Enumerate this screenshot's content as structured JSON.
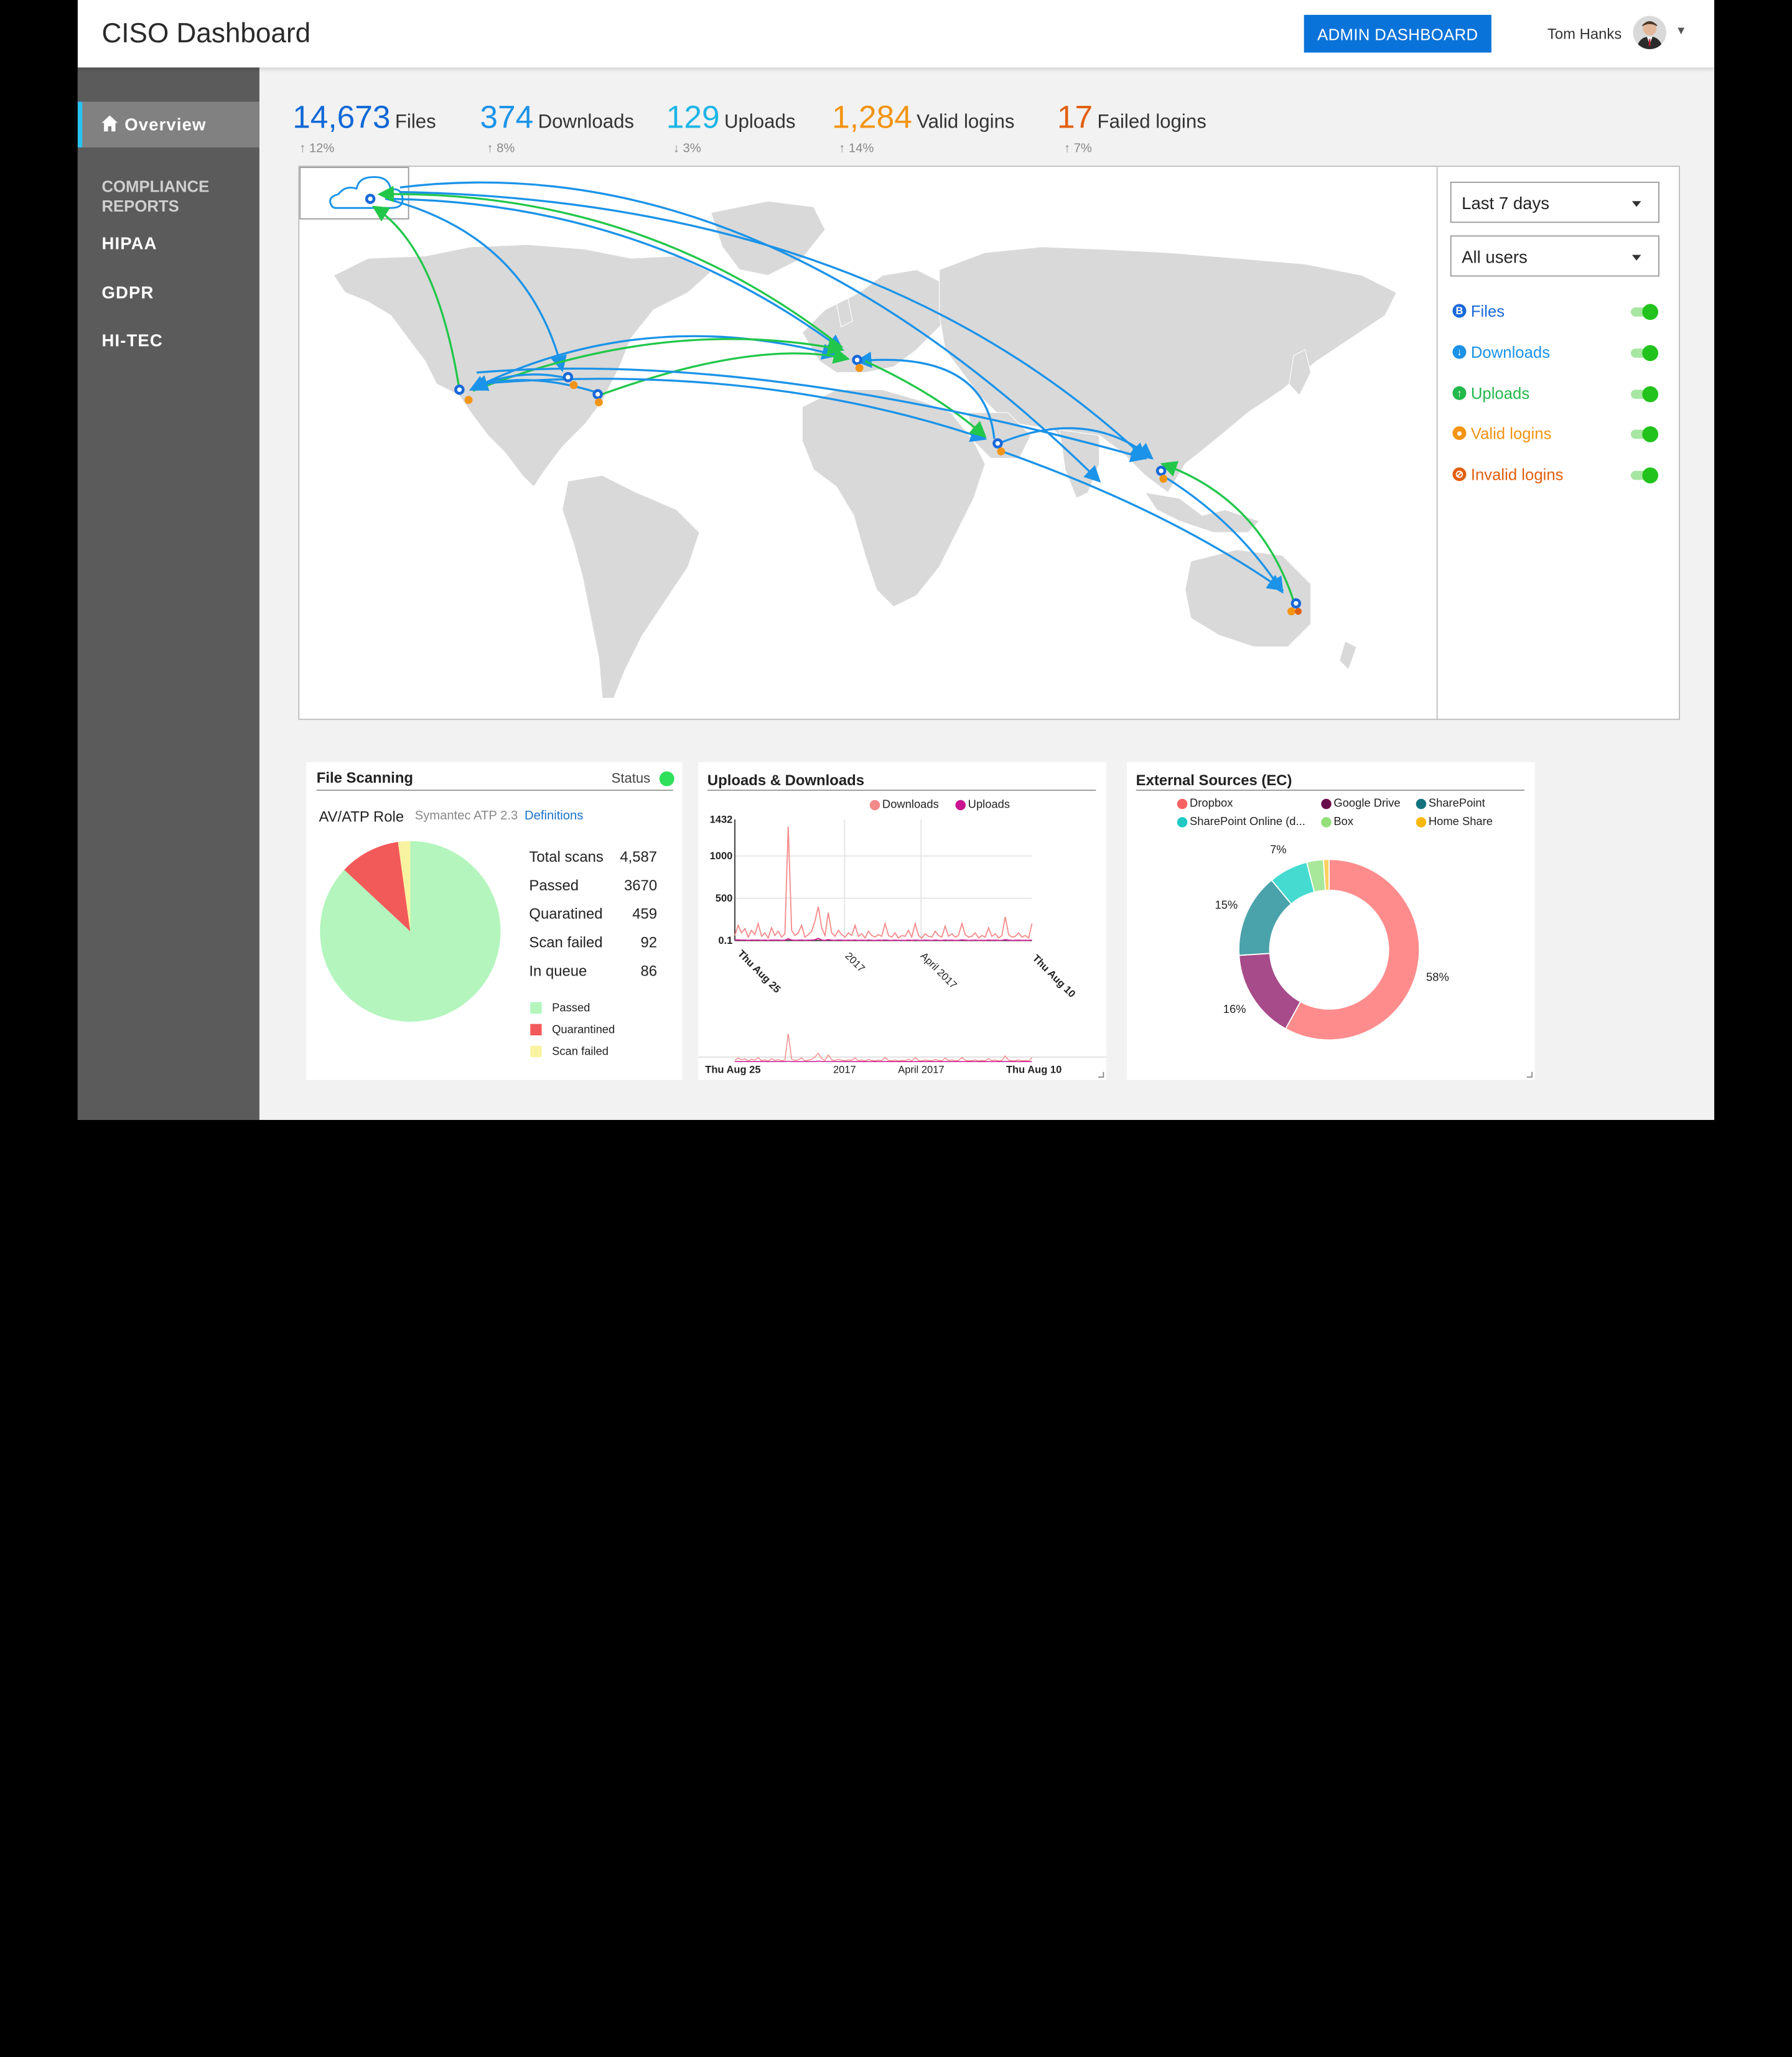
{
  "header": {
    "title": "CISO Dashboard",
    "admin_button": "ADMIN DASHBOARD",
    "user_name": "Tom Hanks"
  },
  "sidebar": {
    "overview": "Overview",
    "compliance_title": "COMPLIANCE REPORTS",
    "reports": [
      {
        "label": "HIPAA",
        "status_color": "#2ee05a"
      },
      {
        "label": "GDPR",
        "status_color": "#2ee05a"
      },
      {
        "label": "HI-TEC",
        "status_color": "#f5b92c"
      }
    ]
  },
  "kpis": [
    {
      "value": "14,673",
      "label": "Files",
      "change": "12%",
      "direction": "up",
      "color": "#0f68d6"
    },
    {
      "value": "374",
      "label": "Downloads",
      "change": "8%",
      "direction": "up",
      "color": "#1b93e8"
    },
    {
      "value": "129",
      "label": "Uploads",
      "change": "3%",
      "direction": "down",
      "color": "#1db5e6"
    },
    {
      "value": "1,284",
      "label": "Valid logins",
      "change": "14%",
      "direction": "up",
      "color": "#f39414"
    },
    {
      "value": "17",
      "label": "Failed logins",
      "change": "7%",
      "direction": "up",
      "color": "#e25f0e"
    }
  ],
  "filters": {
    "period": "Last 7 days",
    "users": "All users",
    "layers": [
      {
        "label": "Files",
        "color": "#1969d9",
        "icon": "files-icon",
        "enabled": true
      },
      {
        "label": "Downloads",
        "color": "#1b93e8",
        "icon": "download-icon",
        "enabled": true
      },
      {
        "label": "Uploads",
        "color": "#22b84a",
        "icon": "upload-icon",
        "enabled": true
      },
      {
        "label": "Valid logins",
        "color": "#f39414",
        "icon": "user-icon",
        "enabled": true
      },
      {
        "label": "Invalid logins",
        "color": "#e25f0e",
        "icon": "blocked-icon",
        "enabled": true
      }
    ]
  },
  "file_scanning": {
    "title": "File Scanning",
    "status_label": "Status",
    "status_color": "#2ee05a",
    "role_label": "AV/ATP Role",
    "engine": "Symantec ATP 2.3",
    "definitions_link": "Definitions",
    "stats": [
      {
        "label": "Total scans",
        "value": "4,587"
      },
      {
        "label": "Passed",
        "value": "3670"
      },
      {
        "label": "Quaratined",
        "value": "459"
      },
      {
        "label": "Scan failed",
        "value": "92"
      },
      {
        "label": "In queue",
        "value": "86"
      }
    ],
    "legend": [
      {
        "label": "Passed",
        "color": "#b3f5bd"
      },
      {
        "label": "Quarantined",
        "color": "#f25a5a"
      },
      {
        "label": "Scan failed",
        "color": "#f7f3a0"
      }
    ]
  },
  "uploads_downloads": {
    "title": "Uploads & Downloads",
    "legend": [
      {
        "label": "Downloads",
        "color": "#f58a8a"
      },
      {
        "label": "Uploads",
        "color": "#c9158f"
      }
    ],
    "y_ticks": [
      "1432",
      "1000",
      "500",
      "0.1"
    ],
    "x_ticks": [
      "Thu Aug 25",
      "2017",
      "April 2017",
      "Thu Aug 10"
    ],
    "nav_ticks": [
      "Thu Aug 25",
      "2017",
      "April 2017",
      "Thu Aug 10"
    ]
  },
  "external_sources": {
    "title": "External Sources (EC)",
    "legend": [
      {
        "label": "Dropbox",
        "color": "#f76262"
      },
      {
        "label": "Google Drive",
        "color": "#6b0a4a"
      },
      {
        "label": "SharePoint",
        "color": "#13727e"
      },
      {
        "label": "SharePoint Online (d...",
        "color": "#21c9c4"
      },
      {
        "label": "Box",
        "color": "#93e07a"
      },
      {
        "label": "Home Share",
        "color": "#f9b810"
      }
    ]
  },
  "chart_data": [
    {
      "type": "pie",
      "title": "File Scanning",
      "categories": [
        "Passed",
        "Quarantined",
        "Scan failed"
      ],
      "values": [
        3670,
        459,
        92
      ],
      "colors": [
        "#b3f5bd",
        "#f25a5a",
        "#f7f3a0"
      ]
    },
    {
      "type": "line",
      "title": "Uploads & Downloads",
      "ylim": [
        0.1,
        1432
      ],
      "series": [
        {
          "name": "Downloads",
          "color": "#f58a8a",
          "values": [
            60,
            180,
            90,
            140,
            40,
            120,
            70,
            200,
            50,
            90,
            30,
            150,
            60,
            110,
            40,
            80,
            1350,
            120,
            60,
            90,
            180,
            40,
            70,
            110,
            230,
            400,
            150,
            60,
            330,
            90,
            50,
            120,
            70,
            40,
            90,
            60,
            180,
            50,
            80,
            30,
            110,
            60,
            40,
            70,
            50,
            200,
            60,
            40,
            90,
            30,
            60,
            50,
            120,
            40,
            200,
            60,
            30,
            80,
            50,
            40,
            110,
            60,
            40,
            170,
            50,
            80,
            40,
            60,
            200,
            70,
            40,
            50,
            90,
            30,
            60,
            40,
            150,
            50,
            80,
            30,
            60,
            280,
            70,
            40,
            50,
            90,
            40,
            60,
            30,
            200
          ]
        },
        {
          "name": "Uploads",
          "color": "#c9158f",
          "values": [
            5,
            8,
            4,
            6,
            3,
            5,
            4,
            6,
            3,
            5,
            2,
            6,
            4,
            5,
            3,
            4,
            20,
            5,
            3,
            4,
            6,
            3,
            4,
            5,
            8,
            25,
            6,
            3,
            10,
            4,
            3,
            5,
            4,
            2,
            4,
            3,
            6,
            2,
            4,
            2,
            5,
            3,
            2,
            4,
            3,
            6,
            3,
            2,
            4,
            2,
            3,
            2,
            5,
            2,
            6,
            3,
            2,
            4,
            3,
            2,
            5,
            3,
            2,
            6,
            3,
            4,
            2,
            3,
            7,
            4,
            2,
            3,
            4,
            2,
            3,
            2,
            6,
            3,
            4,
            2,
            3,
            9,
            4,
            2,
            3,
            4,
            2,
            3,
            2,
            6
          ]
        }
      ]
    },
    {
      "type": "pie",
      "title": "External Sources (EC)",
      "donut": true,
      "categories": [
        "Dropbox",
        "Google Drive",
        "SharePoint",
        "SharePoint Online (d...",
        "Box",
        "Home Share"
      ],
      "values": [
        58,
        16,
        15,
        7,
        3,
        1
      ],
      "data_labels": [
        "58%",
        "16%",
        "15%",
        "7%",
        "",
        ""
      ],
      "colors": [
        "#fe8c8c",
        "#a74b8a",
        "#4aa2ab",
        "#46dbd1",
        "#a8e89a",
        "#fad05e"
      ]
    }
  ]
}
